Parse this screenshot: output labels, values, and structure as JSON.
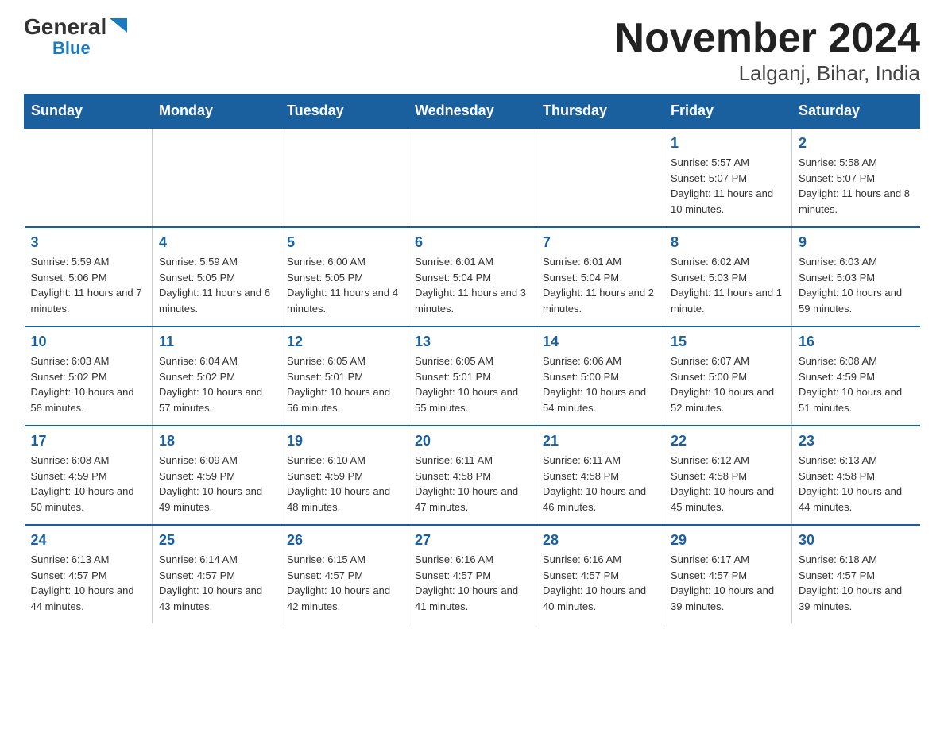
{
  "logo": {
    "general": "General",
    "blue": "Blue",
    "triangle": "▼"
  },
  "title": "November 2024",
  "subtitle": "Lalganj, Bihar, India",
  "header_days": [
    "Sunday",
    "Monday",
    "Tuesday",
    "Wednesday",
    "Thursday",
    "Friday",
    "Saturday"
  ],
  "weeks": [
    [
      {
        "day": "",
        "info": ""
      },
      {
        "day": "",
        "info": ""
      },
      {
        "day": "",
        "info": ""
      },
      {
        "day": "",
        "info": ""
      },
      {
        "day": "",
        "info": ""
      },
      {
        "day": "1",
        "info": "Sunrise: 5:57 AM\nSunset: 5:07 PM\nDaylight: 11 hours and 10 minutes."
      },
      {
        "day": "2",
        "info": "Sunrise: 5:58 AM\nSunset: 5:07 PM\nDaylight: 11 hours and 8 minutes."
      }
    ],
    [
      {
        "day": "3",
        "info": "Sunrise: 5:59 AM\nSunset: 5:06 PM\nDaylight: 11 hours and 7 minutes."
      },
      {
        "day": "4",
        "info": "Sunrise: 5:59 AM\nSunset: 5:05 PM\nDaylight: 11 hours and 6 minutes."
      },
      {
        "day": "5",
        "info": "Sunrise: 6:00 AM\nSunset: 5:05 PM\nDaylight: 11 hours and 4 minutes."
      },
      {
        "day": "6",
        "info": "Sunrise: 6:01 AM\nSunset: 5:04 PM\nDaylight: 11 hours and 3 minutes."
      },
      {
        "day": "7",
        "info": "Sunrise: 6:01 AM\nSunset: 5:04 PM\nDaylight: 11 hours and 2 minutes."
      },
      {
        "day": "8",
        "info": "Sunrise: 6:02 AM\nSunset: 5:03 PM\nDaylight: 11 hours and 1 minute."
      },
      {
        "day": "9",
        "info": "Sunrise: 6:03 AM\nSunset: 5:03 PM\nDaylight: 10 hours and 59 minutes."
      }
    ],
    [
      {
        "day": "10",
        "info": "Sunrise: 6:03 AM\nSunset: 5:02 PM\nDaylight: 10 hours and 58 minutes."
      },
      {
        "day": "11",
        "info": "Sunrise: 6:04 AM\nSunset: 5:02 PM\nDaylight: 10 hours and 57 minutes."
      },
      {
        "day": "12",
        "info": "Sunrise: 6:05 AM\nSunset: 5:01 PM\nDaylight: 10 hours and 56 minutes."
      },
      {
        "day": "13",
        "info": "Sunrise: 6:05 AM\nSunset: 5:01 PM\nDaylight: 10 hours and 55 minutes."
      },
      {
        "day": "14",
        "info": "Sunrise: 6:06 AM\nSunset: 5:00 PM\nDaylight: 10 hours and 54 minutes."
      },
      {
        "day": "15",
        "info": "Sunrise: 6:07 AM\nSunset: 5:00 PM\nDaylight: 10 hours and 52 minutes."
      },
      {
        "day": "16",
        "info": "Sunrise: 6:08 AM\nSunset: 4:59 PM\nDaylight: 10 hours and 51 minutes."
      }
    ],
    [
      {
        "day": "17",
        "info": "Sunrise: 6:08 AM\nSunset: 4:59 PM\nDaylight: 10 hours and 50 minutes."
      },
      {
        "day": "18",
        "info": "Sunrise: 6:09 AM\nSunset: 4:59 PM\nDaylight: 10 hours and 49 minutes."
      },
      {
        "day": "19",
        "info": "Sunrise: 6:10 AM\nSunset: 4:59 PM\nDaylight: 10 hours and 48 minutes."
      },
      {
        "day": "20",
        "info": "Sunrise: 6:11 AM\nSunset: 4:58 PM\nDaylight: 10 hours and 47 minutes."
      },
      {
        "day": "21",
        "info": "Sunrise: 6:11 AM\nSunset: 4:58 PM\nDaylight: 10 hours and 46 minutes."
      },
      {
        "day": "22",
        "info": "Sunrise: 6:12 AM\nSunset: 4:58 PM\nDaylight: 10 hours and 45 minutes."
      },
      {
        "day": "23",
        "info": "Sunrise: 6:13 AM\nSunset: 4:58 PM\nDaylight: 10 hours and 44 minutes."
      }
    ],
    [
      {
        "day": "24",
        "info": "Sunrise: 6:13 AM\nSunset: 4:57 PM\nDaylight: 10 hours and 44 minutes."
      },
      {
        "day": "25",
        "info": "Sunrise: 6:14 AM\nSunset: 4:57 PM\nDaylight: 10 hours and 43 minutes."
      },
      {
        "day": "26",
        "info": "Sunrise: 6:15 AM\nSunset: 4:57 PM\nDaylight: 10 hours and 42 minutes."
      },
      {
        "day": "27",
        "info": "Sunrise: 6:16 AM\nSunset: 4:57 PM\nDaylight: 10 hours and 41 minutes."
      },
      {
        "day": "28",
        "info": "Sunrise: 6:16 AM\nSunset: 4:57 PM\nDaylight: 10 hours and 40 minutes."
      },
      {
        "day": "29",
        "info": "Sunrise: 6:17 AM\nSunset: 4:57 PM\nDaylight: 10 hours and 39 minutes."
      },
      {
        "day": "30",
        "info": "Sunrise: 6:18 AM\nSunset: 4:57 PM\nDaylight: 10 hours and 39 minutes."
      }
    ]
  ]
}
